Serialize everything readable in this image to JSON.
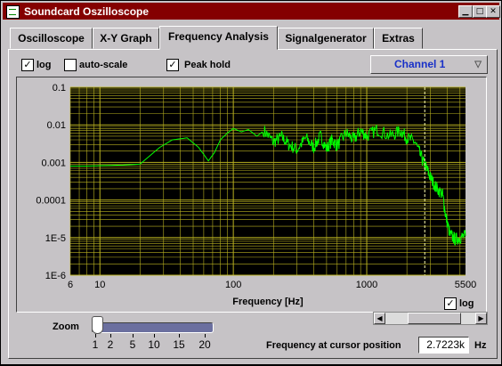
{
  "window": {
    "title": "Soundcard Oszilloscope"
  },
  "tabs": [
    {
      "label": "Oscilloscope",
      "active": false
    },
    {
      "label": "X-Y Graph",
      "active": false
    },
    {
      "label": "Frequency Analysis",
      "active": true
    },
    {
      "label": "Signalgenerator",
      "active": false
    },
    {
      "label": "Extras",
      "active": false
    }
  ],
  "options": {
    "log_label": "log",
    "log_checked": true,
    "autoscale_label": "auto-scale",
    "autoscale_checked": false,
    "peakhold_label": "Peak hold",
    "peakhold_checked": true
  },
  "channel": {
    "selected": "Channel 1"
  },
  "graph": {
    "x_log_label": "log",
    "x_log_checked": true,
    "cursor_frequency_hz": 2722.3
  },
  "zoom": {
    "label": "Zoom",
    "ticks": [
      "1",
      "2",
      "5",
      "10",
      "15",
      "20"
    ],
    "value": 1
  },
  "cursor": {
    "label": "Frequency at cursor position",
    "value": "2.7223k",
    "unit": "Hz"
  },
  "colors": {
    "plot_bg": "#000000",
    "grid": "#b8b020",
    "trace": "#00ff00",
    "titlebar": "#840000",
    "channel_text": "#1830c8"
  },
  "chart_data": {
    "type": "line",
    "xlabel": "Frequency [Hz]",
    "ylabel": "",
    "x_scale": "log",
    "y_scale": "log",
    "xlim": [
      6,
      5500
    ],
    "ylim": [
      1e-06,
      0.1
    ],
    "x_ticks": [
      "6",
      "10",
      "100",
      "1000",
      "5500"
    ],
    "y_ticks": [
      "0.1",
      "0.01",
      "0.001",
      "0.0001",
      "1E-5",
      "1E-6"
    ],
    "grid": true,
    "series": [
      {
        "x": [
          6,
          8,
          10,
          15,
          20,
          28,
          35,
          45,
          55,
          65,
          72,
          80,
          90,
          100,
          115,
          130,
          150,
          170,
          200,
          230,
          260,
          300,
          350,
          400,
          450,
          500,
          550,
          600,
          700,
          800,
          900,
          1000,
          1200,
          1500,
          1800,
          2000,
          2300,
          2600,
          2800,
          3000,
          3300,
          3700,
          3900,
          4200,
          4600,
          5000,
          5500
        ],
        "y": [
          0.0008,
          0.0008,
          0.00082,
          0.00085,
          0.0009,
          0.0025,
          0.004,
          0.0045,
          0.0025,
          0.0011,
          0.0018,
          0.004,
          0.006,
          0.008,
          0.0065,
          0.0075,
          0.005,
          0.007,
          0.0035,
          0.0048,
          0.003,
          0.0022,
          0.0045,
          0.0025,
          0.005,
          0.0023,
          0.004,
          0.0028,
          0.006,
          0.004,
          0.007,
          0.005,
          0.0075,
          0.005,
          0.007,
          0.0045,
          0.0035,
          0.0012,
          0.0007,
          0.0004,
          0.00022,
          0.00014,
          4e-05,
          1.2e-05,
          9e-06,
          1e-05,
          1.1e-05
        ]
      }
    ]
  }
}
